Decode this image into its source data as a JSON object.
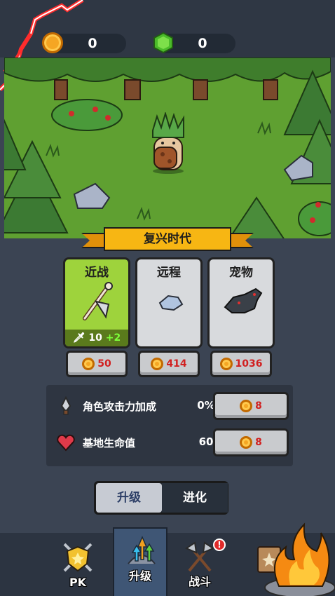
{
  "resources": {
    "gold": "0",
    "gem": "0"
  },
  "era": {
    "title": "复兴时代"
  },
  "categories": [
    {
      "label": "近战",
      "level": "10",
      "bonus": "+2",
      "cost": "50"
    },
    {
      "label": "远程",
      "cost": "414"
    },
    {
      "label": "宠物",
      "cost": "1036"
    }
  ],
  "stats": [
    {
      "label": "角色攻击力加成",
      "value": "0%",
      "cost": "8",
      "icon": "sword-icon"
    },
    {
      "label": "基地生命值",
      "value": "60",
      "cost": "8",
      "icon": "heart-icon"
    }
  ],
  "mode_toggle": {
    "upgrade": "升级",
    "evolve": "进化",
    "selected": "upgrade"
  },
  "nav": [
    {
      "label": "PK",
      "icon": "shield-swords-icon"
    },
    {
      "label": "升级",
      "icon": "upgrade-arrows-icon",
      "active": true
    },
    {
      "label": "战斗",
      "icon": "crossed-axes-icon",
      "badge": "!"
    },
    {
      "label": "",
      "icon": "spellbook-icon"
    }
  ],
  "colors": {
    "accent_green": "#9ed33c",
    "cost_red": "#d12020",
    "banner_gold": "#f7b613",
    "gem_green": "#4bbb2a",
    "coin_gold": "#f5a623"
  }
}
